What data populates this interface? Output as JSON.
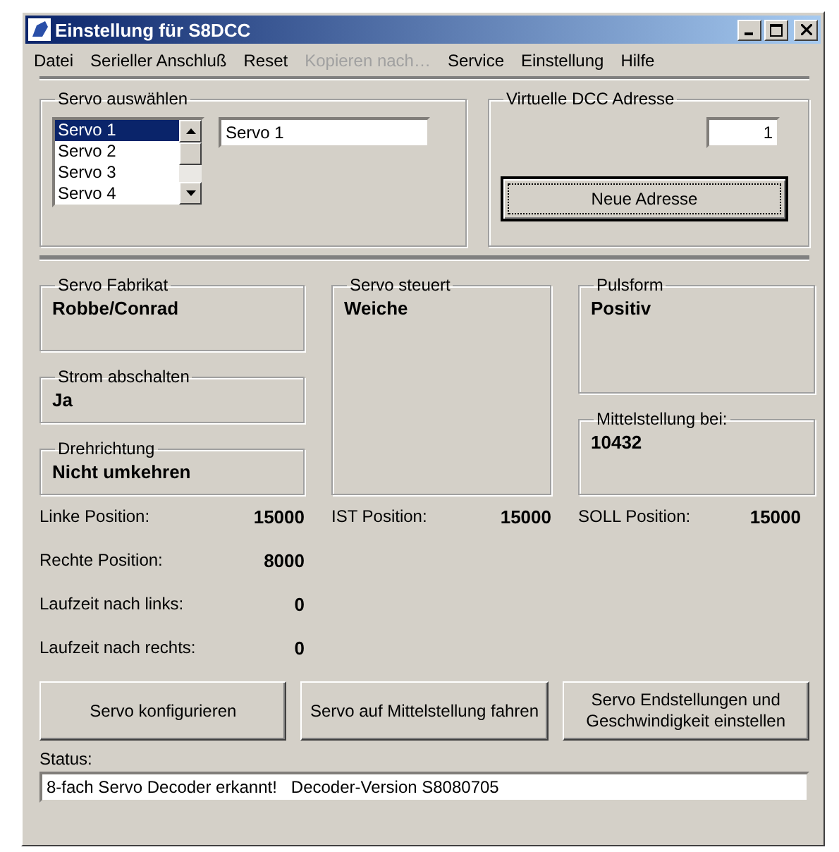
{
  "window": {
    "title": "Einstellung für S8DCC"
  },
  "menu": [
    {
      "label": "Datei",
      "disabled": false
    },
    {
      "label": "Serieller Anschluß",
      "disabled": false
    },
    {
      "label": "Reset",
      "disabled": false
    },
    {
      "label": "Kopieren nach…",
      "disabled": true
    },
    {
      "label": "Service",
      "disabled": false
    },
    {
      "label": "Einstellung",
      "disabled": false
    },
    {
      "label": "Hilfe",
      "disabled": false
    }
  ],
  "servo_select": {
    "label": "Servo auswählen",
    "items": [
      {
        "label": "Servo 1",
        "selected": true
      },
      {
        "label": "Servo 2",
        "selected": false
      },
      {
        "label": "Servo 3",
        "selected": false
      },
      {
        "label": "Servo 4",
        "selected": false
      }
    ],
    "name_field": "Servo 1"
  },
  "dcc_address": {
    "label": "Virtuelle DCC Adresse",
    "value": "1",
    "button": "Neue Adresse"
  },
  "columns": [
    {
      "groups": [
        {
          "label": "Servo Fabrikat",
          "value": "Robbe/Conrad"
        },
        {
          "label": "Strom abschalten",
          "value": "Ja"
        },
        {
          "label": "Drehrichtung",
          "value": "Nicht umkehren"
        }
      ],
      "readouts": [
        {
          "label": "Linke Position:",
          "value": "15000"
        },
        {
          "label": "Rechte Position:",
          "value": "8000"
        },
        {
          "label": "Laufzeit nach links:",
          "value": "0"
        },
        {
          "label": "Laufzeit nach rechts:",
          "value": "0"
        }
      ]
    },
    {
      "groups": [
        {
          "label": "Servo steuert",
          "value": "Weiche"
        }
      ],
      "readouts": [
        {
          "label": "IST Position:",
          "value": "15000"
        }
      ]
    },
    {
      "groups": [
        {
          "label": "Pulsform",
          "value": "Positiv"
        },
        {
          "label": "Mittelstellung bei:",
          "value": "10432"
        }
      ],
      "readouts": [
        {
          "label": "SOLL Position:",
          "value": "15000"
        }
      ]
    }
  ],
  "buttons": [
    {
      "label": "Servo konfigurieren"
    },
    {
      "label": "Servo auf Mittelstellung fahren"
    },
    {
      "label": "Servo Endstellungen und Geschwindigkeit einstellen"
    }
  ],
  "status": {
    "label": "Status:",
    "value": "8-fach Servo Decoder erkannt!   Decoder-Version S8080705"
  }
}
